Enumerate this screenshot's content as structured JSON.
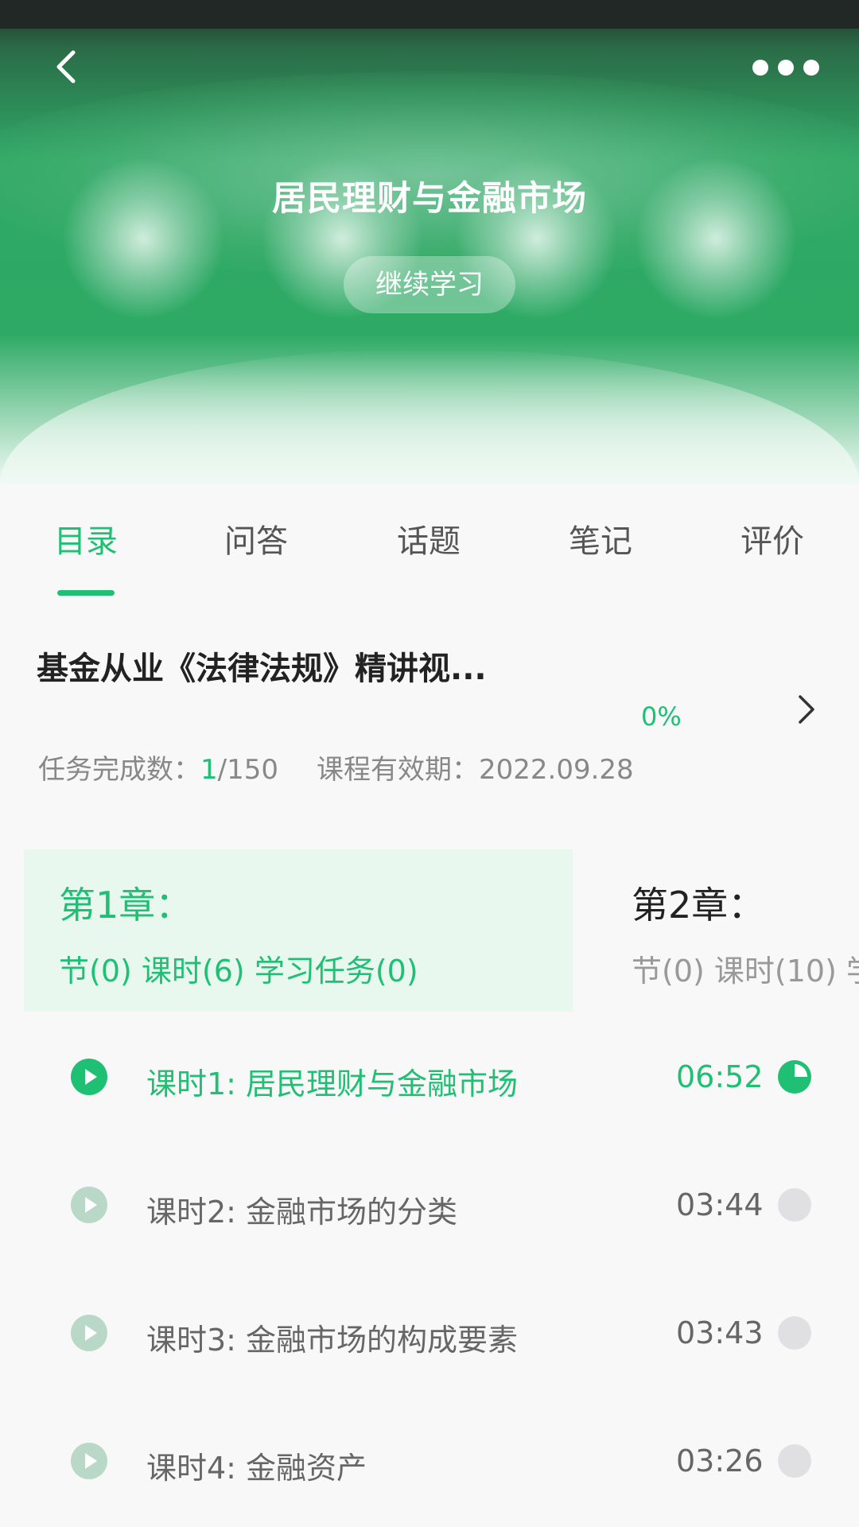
{
  "header": {
    "title": "居民理财与金融市场",
    "continue_label": "继续学习"
  },
  "tabs": [
    {
      "label": "目录",
      "active": true
    },
    {
      "label": "问答",
      "active": false
    },
    {
      "label": "话题",
      "active": false
    },
    {
      "label": "笔记",
      "active": false
    },
    {
      "label": "评价",
      "active": false
    }
  ],
  "course": {
    "name": "基金从业《法律法规》精讲视...",
    "progress": "0%",
    "tasks_label": "任务完成数：",
    "tasks_done": "1",
    "tasks_total": "/150",
    "validity_label": "课程有效期：",
    "validity_date": "2022.09.28"
  },
  "chapters": [
    {
      "title": "第1章：",
      "meta": "节(0) 课时(6) 学习任务(0)",
      "active": true
    },
    {
      "title": "第2章：",
      "meta": "节(0) 课时(10) 学",
      "active": false
    }
  ],
  "lessons": [
    {
      "title": "课时1: 居民理财与金融市场",
      "duration": "06:52",
      "status": "in-progress"
    },
    {
      "title": "课时2: 金融市场的分类",
      "duration": "03:44",
      "status": "not-started"
    },
    {
      "title": "课时3: 金融市场的构成要素",
      "duration": "03:43",
      "status": "not-started"
    },
    {
      "title": "课时4: 金融资产",
      "duration": "03:26",
      "status": "not-started"
    }
  ],
  "colors": {
    "accent": "#1fbf74",
    "banner_green": "#2eaa65",
    "inactive_icon": "#b9d8c8",
    "status_empty": "#e0e0e2"
  },
  "icons": {
    "back": "chevron-left-icon",
    "more": "more-dots-icon",
    "arrow": "chevron-right-icon",
    "play": "play-circle-icon",
    "progress": "progress-pie-icon"
  }
}
